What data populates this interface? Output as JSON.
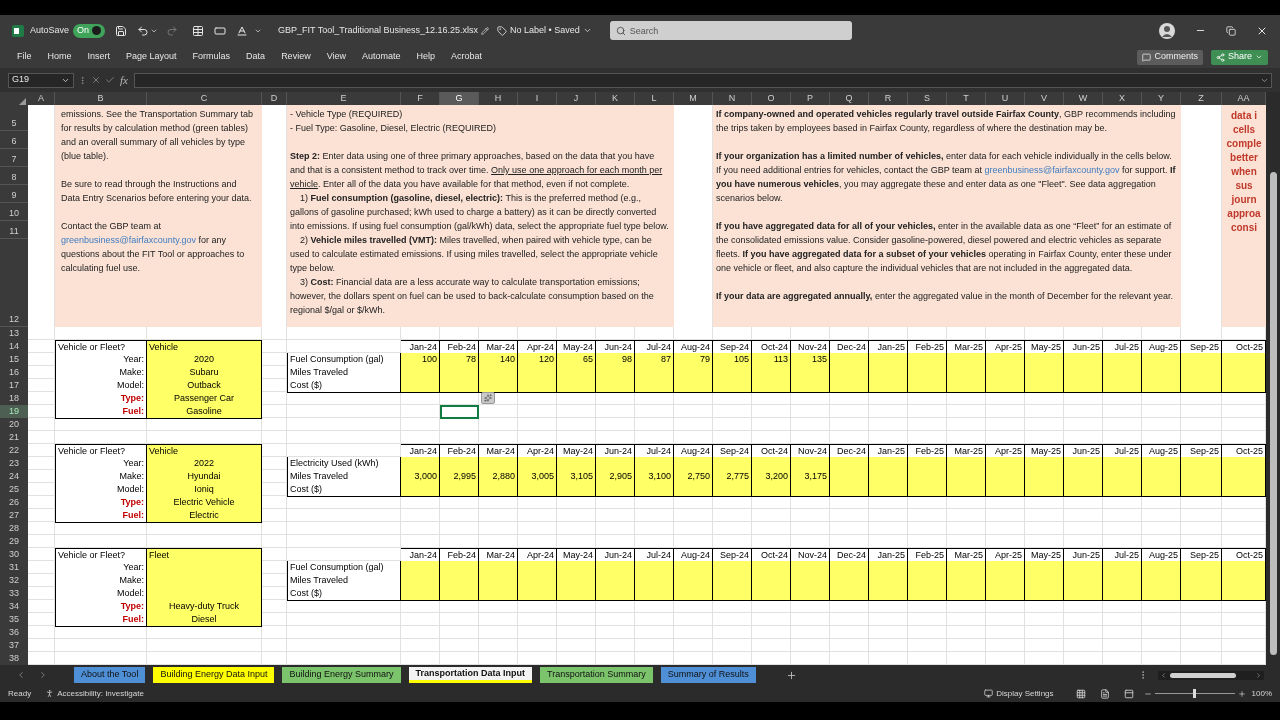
{
  "title_bar": {
    "autosave_label": "AutoSave",
    "autosave_toggle": {
      "label": "On",
      "on": true
    },
    "filename": "GBP_FIT Tool_Traditional Business_12.16.25.xlsx",
    "sensitivity": "No Label • Saved",
    "search": {
      "placeholder": "Search"
    }
  },
  "ribbon": {
    "tabs": [
      {
        "label": "File",
        "selected": false
      },
      {
        "label": "Home",
        "selected": false
      },
      {
        "label": "Insert",
        "selected": false
      },
      {
        "label": "Page Layout",
        "selected": false
      },
      {
        "label": "Formulas",
        "selected": false
      },
      {
        "label": "Data",
        "selected": false
      },
      {
        "label": "Review",
        "selected": false
      },
      {
        "label": "View",
        "selected": false
      },
      {
        "label": "Automate",
        "selected": false
      },
      {
        "label": "Help",
        "selected": false
      },
      {
        "label": "Acrobat",
        "selected": false
      }
    ],
    "buttons": [
      {
        "label": "Comments",
        "kind": "secondary"
      },
      {
        "label": "Share",
        "kind": "primary"
      }
    ]
  },
  "formula_bar": {
    "name_box": "G19",
    "function_label": "fx"
  },
  "columns": [
    {
      "label": "A",
      "selected": false
    },
    {
      "label": "B",
      "selected": false
    },
    {
      "label": "C",
      "selected": false
    },
    {
      "label": "D",
      "selected": false
    },
    {
      "label": "E",
      "selected": false
    },
    {
      "label": "F",
      "selected": false
    },
    {
      "label": "G",
      "selected": true
    },
    {
      "label": "H",
      "selected": false
    },
    {
      "label": "I",
      "selected": false
    },
    {
      "label": "J",
      "selected": false
    },
    {
      "label": "K",
      "selected": false
    },
    {
      "label": "L",
      "selected": false
    },
    {
      "label": "M",
      "selected": false
    },
    {
      "label": "N",
      "selected": false
    },
    {
      "label": "O",
      "selected": false
    },
    {
      "label": "P",
      "selected": false
    },
    {
      "label": "Q",
      "selected": false
    },
    {
      "label": "R",
      "selected": false
    },
    {
      "label": "S",
      "selected": false
    },
    {
      "label": "T",
      "selected": false
    },
    {
      "label": "U",
      "selected": false
    },
    {
      "label": "V",
      "selected": false
    },
    {
      "label": "W",
      "selected": false
    },
    {
      "label": "X",
      "selected": false
    },
    {
      "label": "Y",
      "selected": false
    },
    {
      "label": "Z",
      "selected": false
    },
    {
      "label": "AA",
      "selected": false
    }
  ],
  "instructions": {
    "row_numbers": [
      "5",
      "6",
      "7",
      "8",
      "9",
      "10",
      "11",
      "12"
    ],
    "left": [
      {
        "paragraphs": [
          {
            "indent": false,
            "segments": [
              {
                "t": "emissions. See the Transportation Summary tab for results by calculation method (green tables) and an overall summary of all vehicles by type (blue table).",
                "kind": "plain"
              }
            ]
          }
        ]
      },
      {
        "paragraphs": [
          {
            "indent": false,
            "segments": [
              {
                "t": "Be sure to read through the Instructions and Data Entry Scenarios before entering your data.",
                "kind": "plain"
              }
            ]
          }
        ]
      },
      {
        "paragraphs": [
          {
            "indent": false,
            "segments": [
              {
                "t": "Contact the GBP team at ",
                "kind": "plain"
              },
              {
                "t": "greenbusiness@fairfaxcounty.gov",
                "kind": "link"
              },
              {
                "t": " for any questions about the FIT Tool or approaches to calculating fuel use.",
                "kind": "plain"
              }
            ]
          }
        ]
      }
    ],
    "middle": [
      {
        "paragraphs": [
          {
            "indent": false,
            "segments": [
              {
                "t": "- Vehicle Type (REQUIRED)",
                "kind": "plain"
              }
            ]
          },
          {
            "indent": false,
            "segments": [
              {
                "t": "- Fuel Type: Gasoline, Diesel, Electric (REQUIRED)",
                "kind": "plain"
              }
            ]
          }
        ]
      },
      {
        "paragraphs": [
          {
            "indent": false,
            "segments": [
              {
                "t": "Step 2:",
                "kind": "bold"
              },
              {
                "t": " Enter data using one of three primary approaches, based on the data that you have and that is a consistent method to track over time. ",
                "kind": "plain"
              },
              {
                "t": "Only use one approach for each month per vehicle",
                "kind": "underline"
              },
              {
                "t": ". Enter all of the data you have available for that method, even if not complete.",
                "kind": "plain"
              }
            ]
          },
          {
            "indent": true,
            "segments": [
              {
                "t": "1)  ",
                "kind": "plain"
              },
              {
                "t": "Fuel consumption (gasoline, diesel, electric):",
                "kind": "bold"
              },
              {
                "t": " This is the preferred method (e.g., gallons of gasoline purchased; kWh used to charge a battery) as it can be directly converted into emissions. If using fuel consumption (gal/kWh) data, select the appropriate fuel type below.",
                "kind": "plain"
              }
            ]
          },
          {
            "indent": true,
            "segments": [
              {
                "t": "2)  ",
                "kind": "plain"
              },
              {
                "t": "Vehicle miles travelled (VMT):",
                "kind": "bold"
              },
              {
                "t": " Miles travelled, when paired with vehicle type, can be used to calculate estimated emissions. If using miles travelled, select the appropriate vehicle type below.",
                "kind": "plain"
              }
            ]
          },
          {
            "indent": true,
            "segments": [
              {
                "t": "3)  ",
                "kind": "plain"
              },
              {
                "t": "Cost:",
                "kind": "bold"
              },
              {
                "t": " Financial data are a less accurate way to calculate transportation emissions; however, the dollars spent on fuel can be used to back-calculate consumption based on the regional $/gal or $/kWh.",
                "kind": "plain"
              }
            ]
          }
        ]
      }
    ],
    "right": [
      {
        "paragraphs": [
          {
            "indent": false,
            "segments": [
              {
                "t": "If company-owned and operated vehicles regularly travel outside Fairfax County",
                "kind": "bold"
              },
              {
                "t": ", GBP recommends including the trips taken by employees based in Fairfax County, regardless of where the destination may be.",
                "kind": "plain"
              }
            ]
          }
        ]
      },
      {
        "paragraphs": [
          {
            "indent": false,
            "segments": [
              {
                "t": "If your organization has a limited number of vehicles,",
                "kind": "bold"
              },
              {
                "t": " enter data for each vehicle individually in the cells below. If you need additional entries for vehicles, contact the GBP team at ",
                "kind": "plain"
              },
              {
                "t": "greenbusiness@fairfaxcounty.gov",
                "kind": "link"
              },
              {
                "t": " for support. ",
                "kind": "plain"
              },
              {
                "t": "If you have numerous vehicles",
                "kind": "bold"
              },
              {
                "t": ", you may aggregate these and enter data as one \"Fleet\". See data aggregation scenarios below.",
                "kind": "plain"
              }
            ]
          }
        ]
      },
      {
        "paragraphs": [
          {
            "indent": false,
            "segments": [
              {
                "t": "If you have aggregated data for all of your vehicles,",
                "kind": "bold"
              },
              {
                "t": " enter in the available data as one “Fleet” for an estimate of the consolidated emissions value. Consider gasoline-powered, diesel powered and electric vehicles as separate fleets. ",
                "kind": "plain"
              },
              {
                "t": "If you have aggregated data for a subset of your vehicles",
                "kind": "bold"
              },
              {
                "t": " operating in Fairfax County, enter these under one vehicle or fleet, and also capture the individual vehicles that are not included in the aggregated data.",
                "kind": "plain"
              }
            ]
          }
        ]
      },
      {
        "paragraphs": [
          {
            "indent": false,
            "segments": [
              {
                "t": "If your data are aggregated annually,",
                "kind": "bold"
              },
              {
                "t": " enter the aggregated value in the month of December for the relevant year.",
                "kind": "plain"
              }
            ]
          }
        ]
      }
    ],
    "side_note": [
      "data i",
      "cells",
      "comple",
      "better",
      "when",
      "sus",
      "journ",
      "approa",
      "consi"
    ]
  },
  "sheet_rows": [
    {
      "label": "13",
      "selected": false
    },
    {
      "label": "14",
      "selected": false
    },
    {
      "label": "15",
      "selected": false
    },
    {
      "label": "16",
      "selected": false
    },
    {
      "label": "17",
      "selected": false
    },
    {
      "label": "18",
      "selected": false
    },
    {
      "label": "19",
      "selected": true
    },
    {
      "label": "20",
      "selected": false
    },
    {
      "label": "21",
      "selected": false
    },
    {
      "label": "22",
      "selected": false
    },
    {
      "label": "23",
      "selected": false
    },
    {
      "label": "24",
      "selected": false
    },
    {
      "label": "25",
      "selected": false
    },
    {
      "label": "26",
      "selected": false
    },
    {
      "label": "27",
      "selected": false
    },
    {
      "label": "28",
      "selected": false
    },
    {
      "label": "29",
      "selected": false
    },
    {
      "label": "30",
      "selected": false
    },
    {
      "label": "31",
      "selected": false
    },
    {
      "label": "32",
      "selected": false
    },
    {
      "label": "33",
      "selected": false
    },
    {
      "label": "34",
      "selected": false
    },
    {
      "label": "35",
      "selected": false
    },
    {
      "label": "36",
      "selected": false
    },
    {
      "label": "37",
      "selected": false
    },
    {
      "label": "38",
      "selected": false
    }
  ],
  "vehicles": [
    {
      "fields": [
        {
          "label": "Vehicle or Fleet?",
          "value": "Vehicle",
          "kind": "heading",
          "required": false
        },
        {
          "label": "Year:",
          "value": "2020",
          "kind": "field",
          "required": false
        },
        {
          "label": "Make:",
          "value": "Subaru",
          "kind": "field",
          "required": false
        },
        {
          "label": "Model:",
          "value": "Outback",
          "kind": "field",
          "required": false
        },
        {
          "label": "Type:",
          "value": "Passenger Car",
          "kind": "field",
          "required": true
        },
        {
          "label": "Fuel:",
          "value": "Gasoline",
          "kind": "field",
          "required": true
        }
      ]
    },
    {
      "fields": [
        {
          "label": "Vehicle or Fleet?",
          "value": "Vehicle",
          "kind": "heading",
          "required": false
        },
        {
          "label": "Year:",
          "value": "2022",
          "kind": "field",
          "required": false
        },
        {
          "label": "Make:",
          "value": "Hyundai",
          "kind": "field",
          "required": false
        },
        {
          "label": "Model:",
          "value": "Ioniq",
          "kind": "field",
          "required": false
        },
        {
          "label": "Type:",
          "value": "Electric Vehicle",
          "kind": "field",
          "required": true
        },
        {
          "label": "Fuel:",
          "value": "Electric",
          "kind": "field",
          "required": true
        }
      ]
    },
    {
      "fields": [
        {
          "label": "Vehicle or Fleet?",
          "value": "Fleet",
          "kind": "heading",
          "required": false
        },
        {
          "label": "Year:",
          "kind": "field",
          "required": false
        },
        {
          "label": "Make:",
          "kind": "field",
          "required": false
        },
        {
          "label": "Model:",
          "kind": "field",
          "required": false
        },
        {
          "label": "Type:",
          "value": "Heavy-duty Truck",
          "kind": "field",
          "required": true
        },
        {
          "label": "Fuel:",
          "value": "Diesel",
          "kind": "field",
          "required": true
        }
      ]
    }
  ],
  "data_tables": [
    {
      "months": [
        "Jan-24",
        "Feb-24",
        "Mar-24",
        "Apr-24",
        "May-24",
        "Jun-24",
        "Jul-24",
        "Aug-24",
        "Sep-24",
        "Oct-24",
        "Nov-24",
        "Dec-24",
        "Jan-25",
        "Feb-25",
        "Mar-25",
        "Apr-25",
        "May-25",
        "Jun-25",
        "Jul-25",
        "Aug-25",
        "Sep-25",
        "Oct-25"
      ],
      "rows": [
        {
          "label": "Fuel Consumption (gal)",
          "values": [
            "100",
            "78",
            "140",
            "120",
            "65",
            "98",
            "87",
            "79",
            "105",
            "113",
            "135"
          ]
        },
        {
          "label": "Miles Traveled"
        },
        {
          "label": "Cost ($)"
        }
      ]
    },
    {
      "months": [
        "Jan-24",
        "Feb-24",
        "Mar-24",
        "Apr-24",
        "May-24",
        "Jun-24",
        "Jul-24",
        "Aug-24",
        "Sep-24",
        "Oct-24",
        "Nov-24",
        "Dec-24",
        "Jan-25",
        "Feb-25",
        "Mar-25",
        "Apr-25",
        "May-25",
        "Jun-25",
        "Jul-25",
        "Aug-25",
        "Sep-25",
        "Oct-25"
      ],
      "rows": [
        {
          "label": "Electricity Used (kWh)"
        },
        {
          "label": "Miles Traveled",
          "values": [
            "3,000",
            "2,995",
            "2,880",
            "3,005",
            "3,105",
            "2,905",
            "3,100",
            "2,750",
            "2,775",
            "3,200",
            "3,175"
          ]
        },
        {
          "label": "Cost ($)"
        }
      ]
    },
    {
      "months": [
        "Jan-24",
        "Feb-24",
        "Mar-24",
        "Apr-24",
        "May-24",
        "Jun-24",
        "Jul-24",
        "Aug-24",
        "Sep-24",
        "Oct-24",
        "Nov-24",
        "Dec-24",
        "Jan-25",
        "Feb-25",
        "Mar-25",
        "Apr-25",
        "May-25",
        "Jun-25",
        "Jul-25",
        "Aug-25",
        "Sep-25",
        "Oct-25"
      ],
      "rows": [
        {
          "label": "Fuel Consumption (gal)"
        },
        {
          "label": "Miles Traveled"
        },
        {
          "label": "Cost ($)"
        }
      ]
    }
  ],
  "sheet_tabs": [
    {
      "label": "About the Tool",
      "color": "#4f8fd6",
      "selected": false
    },
    {
      "label": "Building Energy Data Input",
      "color": "#ffff00",
      "selected": false
    },
    {
      "label": "Building Energy Summary",
      "color": "#7cc46c",
      "selected": false
    },
    {
      "label": "Transportation Data Input",
      "color": "#ffff00",
      "selected": true
    },
    {
      "label": "Transportation Summary",
      "color": "#7cc46c",
      "selected": false
    },
    {
      "label": "Summary of Results",
      "color": "#4f8fd6",
      "selected": false
    }
  ],
  "status_bar": {
    "ready": "Ready",
    "accessibility": "Accessibility: Investigate",
    "display_settings": "Display Settings",
    "zoom": "100%",
    "zoom_slider": {
      "level": 0.5
    }
  }
}
